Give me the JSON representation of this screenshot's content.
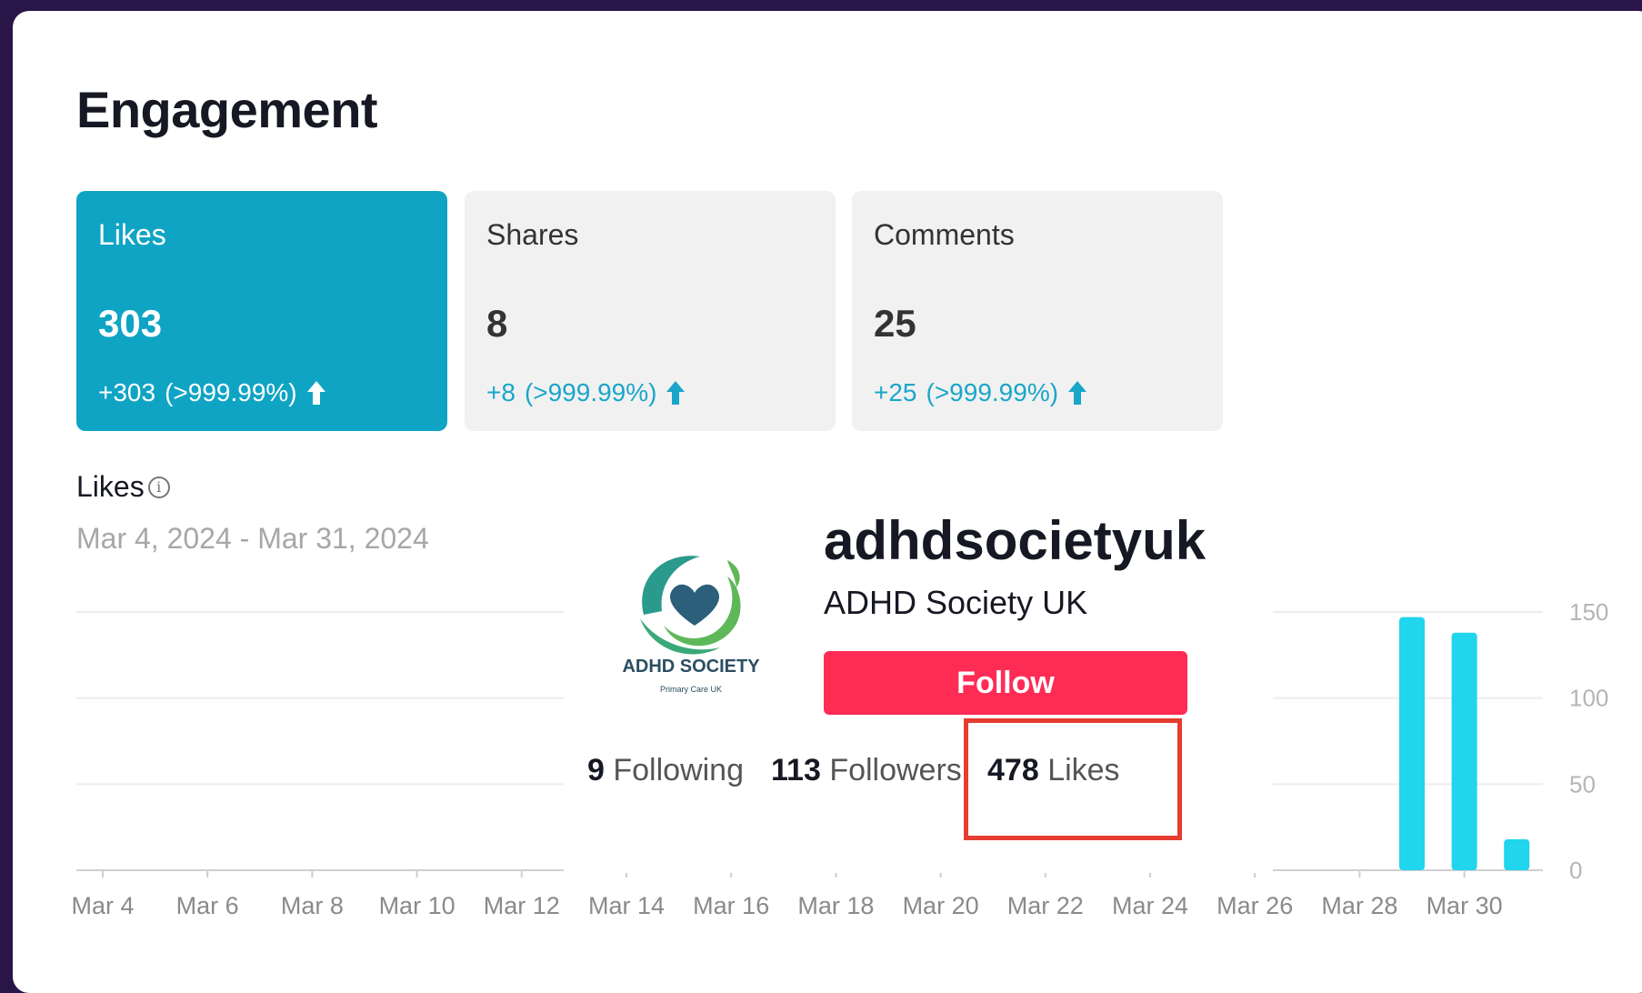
{
  "page": {
    "title": "Engagement"
  },
  "metrics": [
    {
      "label": "Likes",
      "value": "303",
      "change": "+303",
      "pct": "(>999.99%)"
    },
    {
      "label": "Shares",
      "value": "8",
      "change": "+8",
      "pct": "(>999.99%)"
    },
    {
      "label": "Comments",
      "value": "25",
      "change": "+25",
      "pct": "(>999.99%)"
    }
  ],
  "chart_section": {
    "label": "Likes",
    "date_range": "Mar 4, 2024 - Mar 31, 2024"
  },
  "chart_data": {
    "type": "bar",
    "x_tick_labels": [
      "Mar 4",
      "Mar 6",
      "Mar 8",
      "Mar 10",
      "Mar 12",
      "Mar 14",
      "Mar 16",
      "Mar 18",
      "Mar 20",
      "Mar 22",
      "Mar 24",
      "Mar 26",
      "Mar 28",
      "Mar 30"
    ],
    "y_ticks": [
      0,
      50,
      100,
      150
    ],
    "ylim": [
      0,
      150
    ],
    "visible_bars": [
      {
        "date": "Mar 29",
        "value": 147
      },
      {
        "date": "Mar 30",
        "value": 138
      },
      {
        "date": "Mar 31",
        "value": 18
      }
    ],
    "bar_color": "#20d5ec",
    "grid": true
  },
  "profile": {
    "logo_text": "ADHD SOCIETY",
    "logo_subtext": "Primary Care UK",
    "username": "adhdsocietyuk",
    "display_name": "ADHD Society UK",
    "follow_label": "Follow",
    "following_count": "9",
    "following_label": "Following",
    "followers_count": "113",
    "followers_label": "Followers",
    "likes_count": "478",
    "likes_label": "Likes"
  },
  "colors": {
    "accent": "#10a4c4",
    "follow": "#fe2c55",
    "highlight": "#e53d30"
  }
}
